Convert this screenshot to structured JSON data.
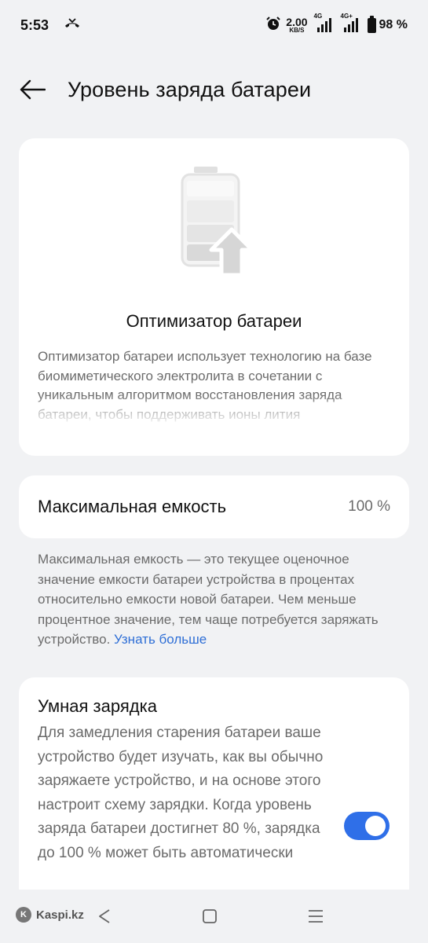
{
  "status_bar": {
    "time": "5:53",
    "net_speed_value": "2.00",
    "net_speed_unit": "KB/S",
    "sim1_tag": "4G",
    "sim2_tag": "4G+",
    "battery_percent": "98 %"
  },
  "header": {
    "title": "Уровень заряда батареи"
  },
  "optimizer": {
    "title": "Оптимизатор батареи",
    "description": "Оптимизатор батареи использует технологию на базе биомиметического электролита в сочетании с уникальным алгоритмом восстановления заряда батареи, чтобы поддерживать ионы лития"
  },
  "capacity": {
    "label": "Максимальная емкость",
    "value": "100 %",
    "description": "Максимальная емкость — это текущее оценочное значение емкости батареи устройства в процентах относительно емкости новой батареи. Чем меньше процентное значение, тем чаще потребуется заряжать устройство.",
    "learn_more": "Узнать больше"
  },
  "smart_charging": {
    "title": "Умная зарядка",
    "description": "Для замедления старения батареи ваше устройство будет изучать, как вы обычно заряжаете устройство, и на основе этого настроит схему зарядки. Когда уровень заряда батареи достигнет 80 %, зарядка до 100 % может быть автоматически",
    "enabled": true
  },
  "watermark": {
    "text": "Kaspi.kz"
  },
  "colors": {
    "accent": "#2f6fe8",
    "link": "#2f6fd6",
    "background": "#f1f2f4",
    "card": "#ffffff"
  }
}
